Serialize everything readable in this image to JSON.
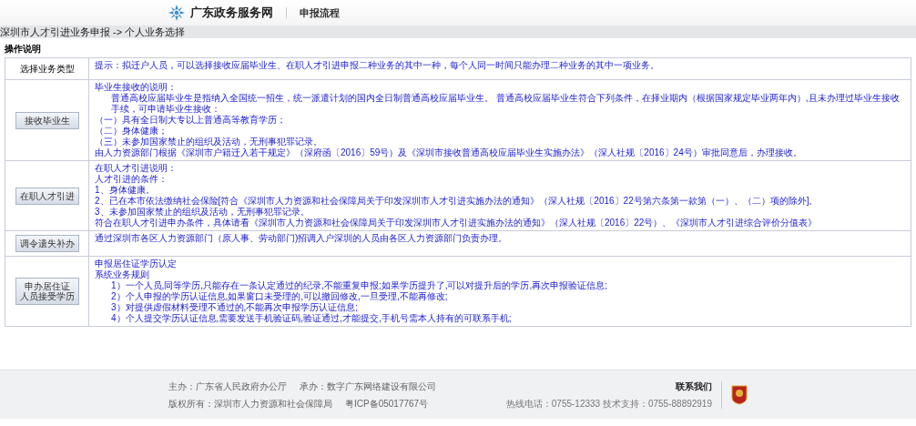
{
  "header": {
    "site_name": "广东政务服务网",
    "section": "申报流程"
  },
  "breadcrumb": "深圳市人才引进业务申报 -> 个人业务选择",
  "section_title": "操作说明",
  "table": {
    "rows": [
      {
        "kind": "header",
        "label": "选择业务类型",
        "lines": [
          {
            "text": "提示：拟迁户人员，可以选择接收应届毕业生、在职人才引进申报二种业务的其中一种，每个人同一时间只能办理二种业务的其中一项业务。",
            "indented": false
          }
        ]
      },
      {
        "kind": "button",
        "label_lines": [
          "接收毕业生"
        ],
        "lines": [
          {
            "text": "毕业生接收的说明：",
            "indented": false
          },
          {
            "text": "普通高校应届毕业生是指纳入全国统一招生，统一派遣计划的国内全日制普通高校应届毕业生。 普通高校应届毕业生符合下列条件，在择业期内（根据国家规定毕业两年内）,且未办理过毕业生接收手续，可申请毕业生接收：",
            "indented": true
          },
          {
            "text": "（一）具有全日制大专以上普通高等教育学历；",
            "indented": false
          },
          {
            "text": "（二）身体健康；",
            "indented": false
          },
          {
            "text": "（三）未参加国家禁止的组织及活动，无刑事犯罪记录。",
            "indented": false
          },
          {
            "text": "由人力资源部门根据《深圳市户籍迁入若干规定》（深府函〔2016〕59号）及《深圳市接收普通高校应届毕业生实施办法》（深人社规〔2016〕24号）审批同意后，办理接收。",
            "indented": false
          }
        ]
      },
      {
        "kind": "button",
        "label_lines": [
          "在职人才引进"
        ],
        "lines": [
          {
            "text": "在职人才引进说明：",
            "indented": false
          },
          {
            "text": "人才引进的条件：",
            "indented": false
          },
          {
            "text": "1、身体健康。",
            "indented": false
          },
          {
            "text": "2、已在本市依法缴纳社会保险[符合《深圳市人力资源和社会保障局关于印发深圳市人才引进实施办法的通知》（深人社规〔2016〕22号第六条第一款第（一）、（二）项的除外]。",
            "indented": false
          },
          {
            "text": "3、未参加国家禁止的组织及活动，无刑事犯罪记录。",
            "indented": false
          },
          {
            "text": "符合在职人才引进申办条件，具体请看《深圳市人力资源和社会保障局关于印发深圳市人才引进实施办法的通知》（深人社规〔2016〕22号）、《深圳市人才引进综合评价分值表》",
            "indented": false
          }
        ]
      },
      {
        "kind": "button",
        "label_lines": [
          "调令遗失补办"
        ],
        "lines": [
          {
            "text": "通过深圳市各区人力资源部门（原人事、劳动部门)招调入户深圳的人员由各区人力资源部门负责办理。",
            "indented": false
          }
        ]
      },
      {
        "kind": "button",
        "label_lines": [
          "申办居住证",
          "人员接受学历"
        ],
        "lines": [
          {
            "text": "申报居住证学历认定",
            "indented": false
          },
          {
            "text": "系统业务规则",
            "indented": false
          },
          {
            "text": "1）一个人员,同等学历,只能存在一条认定通过的纪录,不能重复申报;如果学历提升了,可以对提升后的学历,再次申报验证信息;",
            "indented": true
          },
          {
            "text": "2）个人申报的学历认证信息,如果窗口未受理的,可以撤回修改,一旦受理,不能再修改;",
            "indented": true
          },
          {
            "text": "3）对提供虚假材料受理不通过的,不能再次申报学历认证信息;",
            "indented": true
          },
          {
            "text": "4）个人提交学历认证信息,需要发送手机验证码,验证通过,才能提交,手机号需本人持有的可联系手机;",
            "indented": true
          }
        ]
      }
    ]
  },
  "footer": {
    "sponsor_lines": [
      [
        "主办：广东省人民政府办公厅",
        "承办：数字广东网络建设有限公司"
      ],
      [
        "版权所有：深圳市人力资源和社会保障局",
        "粤ICP备05017767号"
      ]
    ],
    "contact_title": "联系我们",
    "contact_info": "热线电话：0755-12333 技术支持：0755-88892919"
  }
}
